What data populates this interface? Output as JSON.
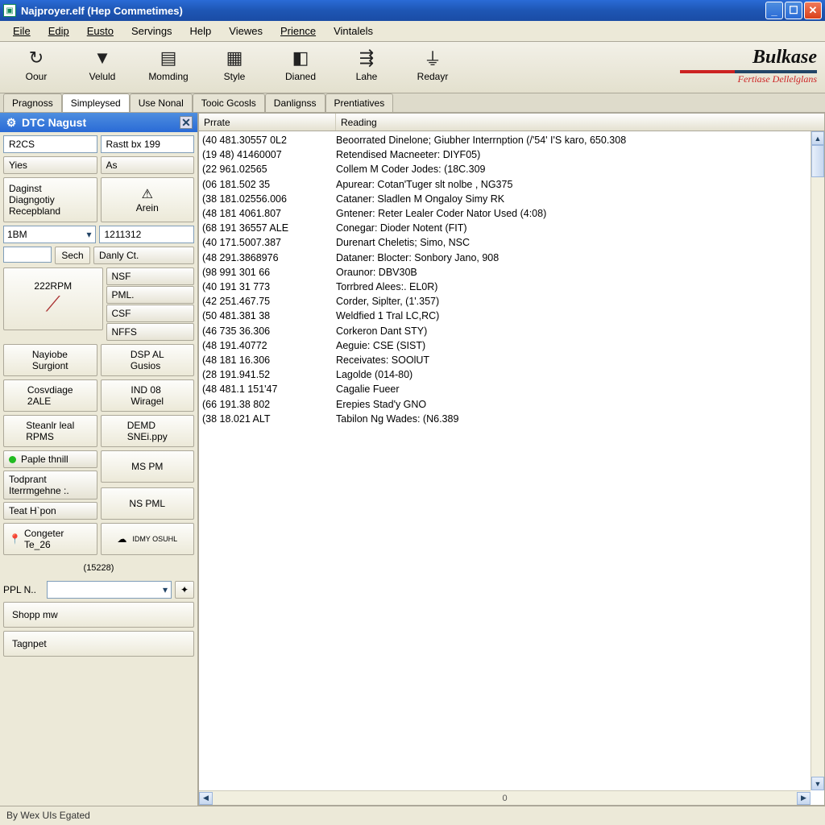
{
  "titlebar": {
    "title": "Najproyer.elf (Hep Commetimes)"
  },
  "menubar": [
    "Eile",
    "Edip",
    "Eusto",
    "Servings",
    "Help",
    "Viewes",
    "Prience",
    "Vintalels"
  ],
  "toolbar": [
    {
      "icon": "↻",
      "label": "Oour"
    },
    {
      "icon": "▼",
      "label": "Veluld"
    },
    {
      "icon": "▤",
      "label": "Momding"
    },
    {
      "icon": "▦",
      "label": "Style"
    },
    {
      "icon": "◧",
      "label": "Dianed"
    },
    {
      "icon": "⇶",
      "label": "Lahe"
    },
    {
      "icon": "⏚",
      "label": "Redayr"
    }
  ],
  "brand": {
    "line1": "Bulkase",
    "line2": "Fertiase Dellelglans"
  },
  "tabs": [
    {
      "label": "Pragnoss",
      "active": false
    },
    {
      "label": "Simpleysed",
      "active": true
    },
    {
      "label": "Use Nonal",
      "active": false
    },
    {
      "label": "Tooic Gcosls",
      "active": false
    },
    {
      "label": "Danlignss",
      "active": false
    },
    {
      "label": "Prentiatives",
      "active": false
    }
  ],
  "sidebar": {
    "panel_title": "DTC Nagust",
    "r1": {
      "a": "R2CS",
      "b": "Rastt bx 199"
    },
    "r2": {
      "a": "Yies",
      "b": "As"
    },
    "diag_box": "Daginst\nDiagngotiy\nRecepbland",
    "arein": "Arein",
    "sel1": "1BM",
    "inp1": "1211312",
    "sech": "Sech",
    "danly": "Danly Ct.",
    "rpm": "222RPM",
    "codes": [
      "NSF",
      "PML.",
      "CSF",
      "NFFS"
    ],
    "g": [
      [
        "Nayiobe\nSurgiont",
        "DSP AL\nGusios"
      ],
      [
        "Cosvdiage\n2ALE",
        "IND 08\nWiragel"
      ],
      [
        "Steanlr leal\nRPMS",
        "DEMD\nSNEi.ppy"
      ]
    ],
    "paple": "Paple thnill",
    "todprant": "Todprant\nIterrmgehne :.",
    "teat": "Teat H`pon",
    "mspm": "MS PM",
    "nspm": "NS PML",
    "congeter": "Congeter\nTe_26",
    "idmy": "IDMY OSUHL",
    "bracket": "(15228)",
    "ppl": "PPL N..",
    "shopp": "Shopp mw",
    "tagnpet": "Tagnpet"
  },
  "columns": {
    "c1": "Prrate",
    "c2": "Reading"
  },
  "rows": [
    {
      "c1": "(40 481.30557 0L2",
      "c2": "Beoorrated Dinelone; Giubher Interrnption (/'54' I'S karo, 650.308"
    },
    {
      "c1": "(19 48) 41460007",
      "c2": "Retendised Macneeter: DIYF05)"
    },
    {
      "c1": "(22 961.02565",
      "c2": "Collem M Coder Jodes: (18C.309"
    },
    {
      "c1": "(06 181.502 35",
      "c2": "Apurear: Cotan'Tuger slt nolbe , NG375"
    },
    {
      "c1": "(38 181.02556.006",
      "c2": "Cataner: Sladlen M Ongaloy Simy RK"
    },
    {
      "c1": "(48 181 4061.807",
      "c2": "Gntener: Reter Lealer Coder Nator Used (4:08)"
    },
    {
      "c1": "(68 191 36557 ALE",
      "c2": "Conegar: Dioder Notent (FIT)"
    },
    {
      "c1": "(40 171.5007.387",
      "c2": "Durenart Cheletis; Simo, NSC"
    },
    {
      "c1": "(48 291.3868976",
      "c2": "Dataner: Blocter: Sonbory Jano, 908"
    },
    {
      "c1": "(98 991 301 66",
      "c2": "Oraunor: DBV30B"
    },
    {
      "c1": "(40 191 31 773",
      "c2": "Torrbred Alees:. EL0R)"
    },
    {
      "c1": "(42 251.467.75",
      "c2": "Corder, Siplter, (1'.357)"
    },
    {
      "c1": "(50 481.381 38",
      "c2": "Weldfied 1 Tral LC,RC)"
    },
    {
      "c1": "(46 735 36.306",
      "c2": "Corkeron Dant STY)"
    },
    {
      "c1": "(48 191.40772",
      "c2": "Aeguie: CSE (SIST)"
    },
    {
      "c1": "(48 181 16.306",
      "c2": "Receivates: SOOlUT"
    },
    {
      "c1": "(28 191.941.52",
      "c2": "Lagolde (014-80)"
    },
    {
      "c1": "(48 481.1 151'47",
      "c2": "Cagalie Fueer"
    },
    {
      "c1": "(66 191.38 802",
      "c2": "Erepies Stad'y GNO"
    },
    {
      "c1": "(38 18.021 ALT",
      "c2": "Tabilon Ng Wades: (N6.389"
    }
  ],
  "hscroll_label": "0",
  "status": "By Wex UIs Egated"
}
